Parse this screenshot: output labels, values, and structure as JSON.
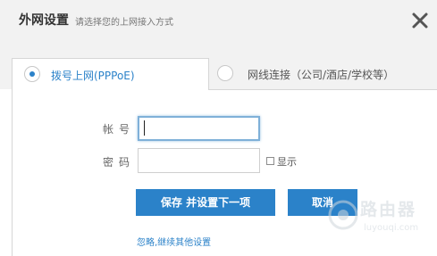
{
  "header": {
    "title": "外网设置",
    "subtitle": "请选择您的上网接入方式",
    "close_icon": "close-icon"
  },
  "tabs": [
    {
      "label": "拨号上网(PPPoE)",
      "selected": true
    },
    {
      "label": "网线连接（公司/酒店/学校等）",
      "selected": false
    }
  ],
  "form": {
    "account_label": "帐号",
    "account_value": "",
    "password_label": "密码",
    "password_value": "",
    "show_label": "显示",
    "show_checked": false
  },
  "buttons": {
    "save_label": "保存 并设置下一项",
    "cancel_label": "取消"
  },
  "links": {
    "ignore_label": "忽略,继续其他设置"
  },
  "watermark": {
    "text": "路由器",
    "sub": "luyouqi.com"
  },
  "colors": {
    "accent": "#2b82c9",
    "header_bg": "#f2f2f2"
  }
}
